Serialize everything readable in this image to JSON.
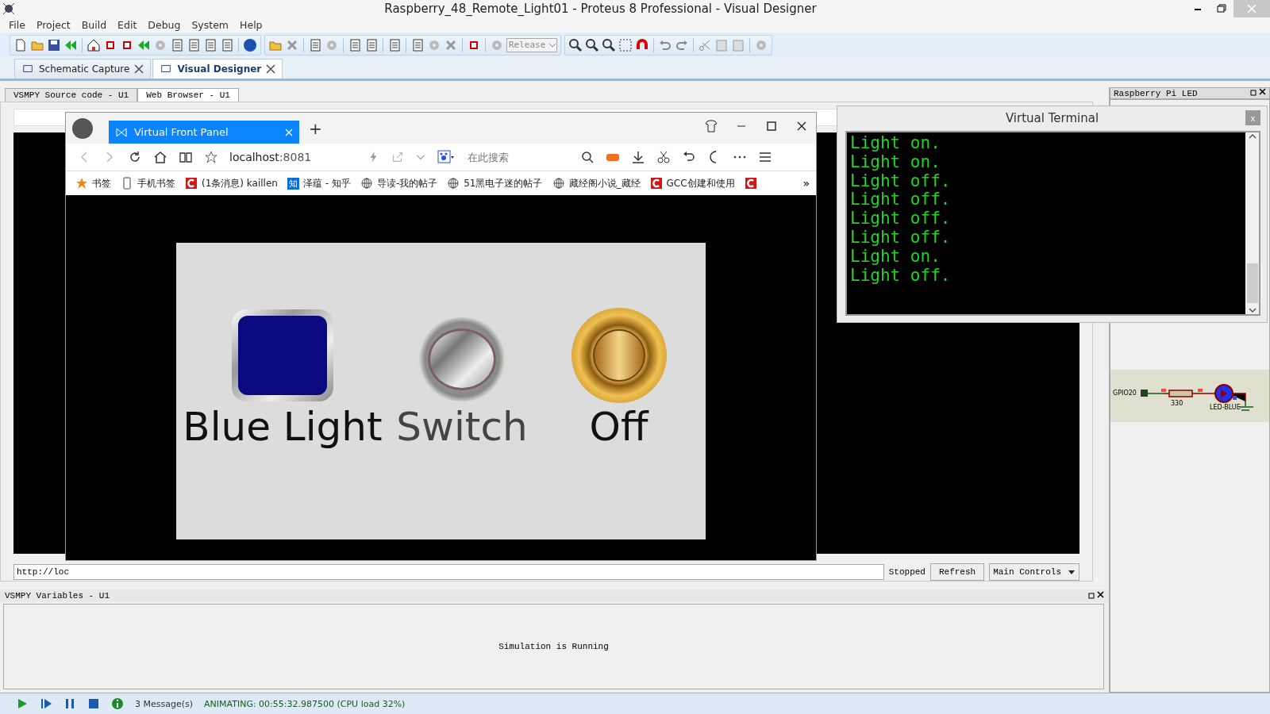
{
  "window": {
    "title": "Raspberry_48_Remote_Light01 - Proteus 8 Professional - Visual Designer"
  },
  "menu": [
    "File",
    "Project",
    "Build",
    "Edit",
    "Debug",
    "System",
    "Help"
  ],
  "toolbar": {
    "build_config": "Release"
  },
  "doc_tabs": [
    {
      "label": "Schematic Capture",
      "selected": false
    },
    {
      "label": "Visual Designer",
      "selected": true
    }
  ],
  "sub_tabs": [
    {
      "label": "VSMPY Source code - U1",
      "selected": false
    },
    {
      "label": "Web Browser - U1",
      "selected": true
    }
  ],
  "browser": {
    "tab_title": "Virtual Front Panel",
    "new_tab": "+",
    "address_host": "localhost",
    "address_port": ":8081",
    "search_placeholder": "在此搜索",
    "bookmarks": [
      {
        "kind": "star",
        "label": "书签"
      },
      {
        "kind": "phone",
        "label": "手机书签"
      },
      {
        "kind": "logo",
        "label": "(1条消息) kaillen"
      },
      {
        "kind": "zhi",
        "mark": "知",
        "label": "泽蕴 - 知乎"
      },
      {
        "kind": "globe",
        "label": "导读-我的帖子"
      },
      {
        "kind": "globe",
        "label": "51黑电子迷的帖子"
      },
      {
        "kind": "globe",
        "label": "藏经阁小说_藏经"
      },
      {
        "kind": "logo",
        "label": "GCC创建和使用"
      },
      {
        "kind": "logo"
      }
    ],
    "more": "»",
    "controls": [
      {
        "kind": "indicator",
        "label": "Blue Light",
        "on": false
      },
      {
        "kind": "toggle",
        "label": "Switch",
        "on": false
      },
      {
        "kind": "button",
        "label": "Off"
      }
    ]
  },
  "url_field": "http://loc",
  "load_status": "Stopped",
  "refresh": "Refresh",
  "view_select": "Main Controls",
  "side_panel": {
    "title": "Raspberry Pi LED",
    "pin": "GPIO20",
    "resistor": "330",
    "led": "LED-BLUE"
  },
  "terminal": {
    "title": "Virtual Terminal",
    "close": "x",
    "lines": [
      "Light on.",
      "Light on.",
      "Light off.",
      "Light off.",
      "Light off.",
      "Light off.",
      "Light on.",
      "Light off."
    ]
  },
  "variables": {
    "title": "VSMPY Variables - U1",
    "message": "Simulation is Running"
  },
  "status_bar": {
    "messages": "3 Message(s)",
    "state": "ANIMATING: 00:55:32.987500 (CPU load 32%)"
  }
}
